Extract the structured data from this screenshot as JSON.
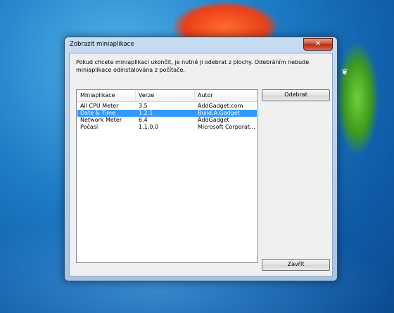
{
  "window": {
    "title": "Zobrazit miniaplikace",
    "close_label": "✕"
  },
  "description": "Pokud chcete miniaplikaci ukončit, je nutné ji odebrat z plochy. Odebráním nebude miniaplikace odinstalována z počítače.",
  "table": {
    "columns": [
      "Miniaplikace",
      "Verze",
      "Autor"
    ],
    "rows": [
      {
        "name": "All CPU Meter",
        "version": "3.5",
        "author": "AddGadget.com"
      },
      {
        "name": "Date & Time",
        "version": "1.2.1",
        "author": "Build.A.Gadget"
      },
      {
        "name": "Network Meter",
        "version": "6.4",
        "author": "AddGadget"
      },
      {
        "name": "Počasí",
        "version": "1.1.0.0",
        "author": "Microsoft Corporat..."
      }
    ],
    "selected_index": 1
  },
  "buttons": {
    "remove": "Odebrat",
    "close": "Zavřít"
  },
  "colors": {
    "selection": "#3399ff",
    "close_button": "#c7462c"
  }
}
